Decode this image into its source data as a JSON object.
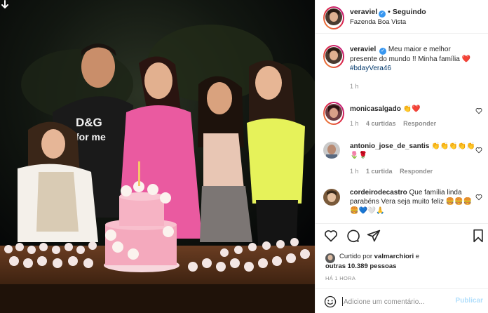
{
  "post": {
    "author": "veraviel",
    "follow_status": "Seguindo",
    "location": "Fazenda Boa Vista"
  },
  "caption": {
    "username": "veraviel",
    "text": "Meu maior e melhor presente do mundo !! Minha família ❤️",
    "hashtag": "#bdayVera46",
    "time": "1 h"
  },
  "comments": [
    {
      "username": "monicasalgado",
      "text": "👏❤️",
      "time": "1 h",
      "likes": "4 curtidas",
      "reply": "Responder"
    },
    {
      "username": "antonio_jose_de_santis",
      "text": "👏👏👏👏👏🌷🌹",
      "time": "1 h",
      "likes": "1 curtida",
      "reply": "Responder"
    },
    {
      "username": "cordeirodecastro",
      "text": "Que família linda parabéns Vera seja muito feliz 🍔🍔🍔🍔💙🤍🙏",
      "time": "",
      "likes": "",
      "reply": ""
    }
  ],
  "liked_by": {
    "prefix": "Curtido por",
    "user": "valmarchiori",
    "connector": "e",
    "others": "outras 10.389 pessoas"
  },
  "timestamp": "HÁ 1 HORA",
  "comment_box": {
    "placeholder": "Adicione um comentário...",
    "publish_label": "Publicar"
  },
  "icons": {
    "download": "download-arrow-icon",
    "like": "heart-icon",
    "comment": "comment-bubble-icon",
    "share": "paper-plane-icon",
    "save": "bookmark-icon",
    "emoji": "smiley-icon"
  },
  "colors": {
    "link": "#00376b",
    "verified": "#3897f0",
    "muted": "#8e8e8e",
    "publish_disabled": "#b2dffc"
  }
}
